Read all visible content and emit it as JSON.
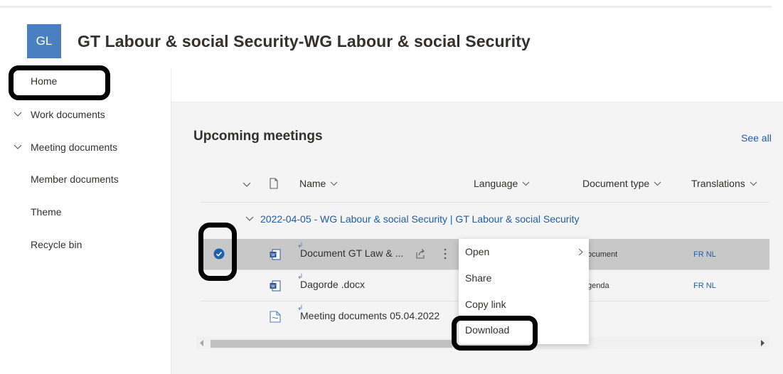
{
  "site": {
    "logo_text": "GL",
    "title": "GT Labour & social Security-WG Labour & social Security"
  },
  "nav": {
    "home": "Home",
    "work_documents": "Work documents",
    "meeting_documents": "Meeting documents",
    "member_documents": "Member documents",
    "theme": "Theme",
    "recycle_bin": "Recycle bin"
  },
  "section": {
    "title": "Upcoming meetings",
    "see_all": "See all"
  },
  "columns": {
    "name": "Name",
    "language": "Language",
    "document_type": "Document type",
    "translations": "Translations"
  },
  "group_label": "2022-04-05 - WG Labour & social Security | GT Labour & social Security",
  "rows": [
    {
      "name": "Document GT Law & ...",
      "doc_type": "ocument",
      "translations": "FR NL",
      "selected": true
    },
    {
      "name": "Dagorde .docx",
      "doc_type": "genda",
      "translations": "FR NL",
      "selected": false
    },
    {
      "name": "Meeting documents 05.04.2022",
      "doc_type": "",
      "translations": "",
      "selected": false
    }
  ],
  "context_menu": {
    "open": "Open",
    "share": "Share",
    "copy_link": "Copy link",
    "download": "Download"
  },
  "colors": {
    "brand": "#4a7fc1",
    "link": "#1f5ea8",
    "selected_row": "#c8c8c8",
    "annotation": "#000000"
  }
}
